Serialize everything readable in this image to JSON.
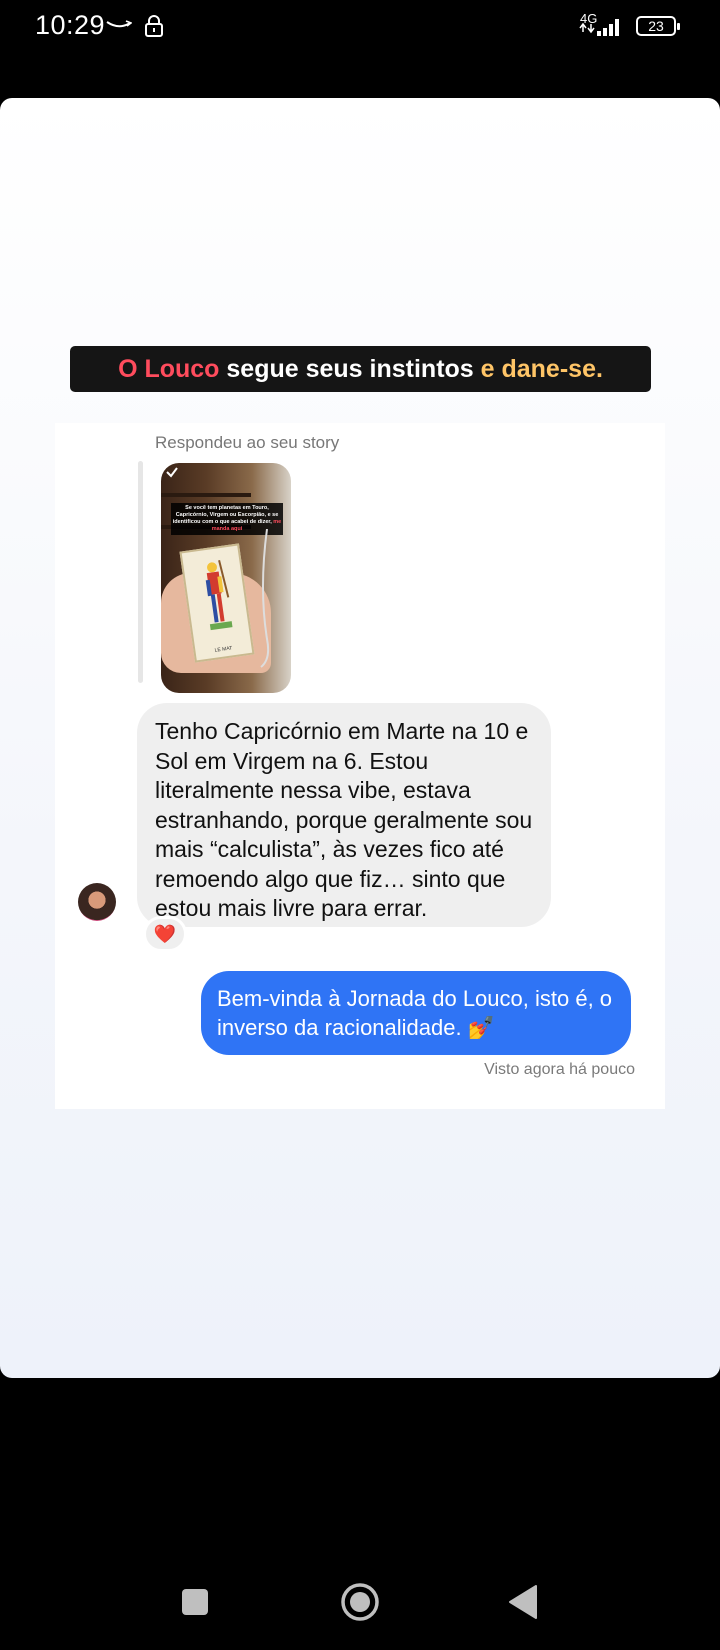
{
  "status_bar": {
    "time": "10:29",
    "network": "4G",
    "battery": "23",
    "icons": [
      "amazon-smile-icon",
      "lock-icon",
      "signal-icon",
      "battery-icon"
    ]
  },
  "story": {
    "headline": {
      "part1": "O Louco",
      "part2": " segue seus instintos ",
      "part3": "e dane-se."
    },
    "colors": {
      "red": "#ff4c5d",
      "yellow": "#ffc567",
      "bubble_blue": "#2f74f5",
      "bubble_gray": "#efefef"
    }
  },
  "chat": {
    "reply_label": "Respondeu ao seu story",
    "story_preview": {
      "caption_line1": "Se você tem planetas em Touro, Capricórnio, Virgem ou Escorpião, e se identificou com o que acabei de dizer,",
      "caption_line2": "me manda aqui",
      "card_label": "LE MAT"
    },
    "incoming_message": "Tenho Capricórnio em Marte na 10 e Sol em Virgem na 6. Estou literalmente nessa vibe, estava estranhando, porque geralmente sou mais “calculista”, às vezes fico até remoendo algo que fiz… sinto que estou mais livre para errar.",
    "reaction": "❤️",
    "outgoing_message": "Bem-vinda à Jornada do Louco, isto é, o inverso da racionalidade. 💅",
    "seen_status": "Visto agora há pouco"
  },
  "nav_bar": {
    "icons": [
      "recent-apps-icon",
      "home-icon",
      "back-icon"
    ]
  }
}
